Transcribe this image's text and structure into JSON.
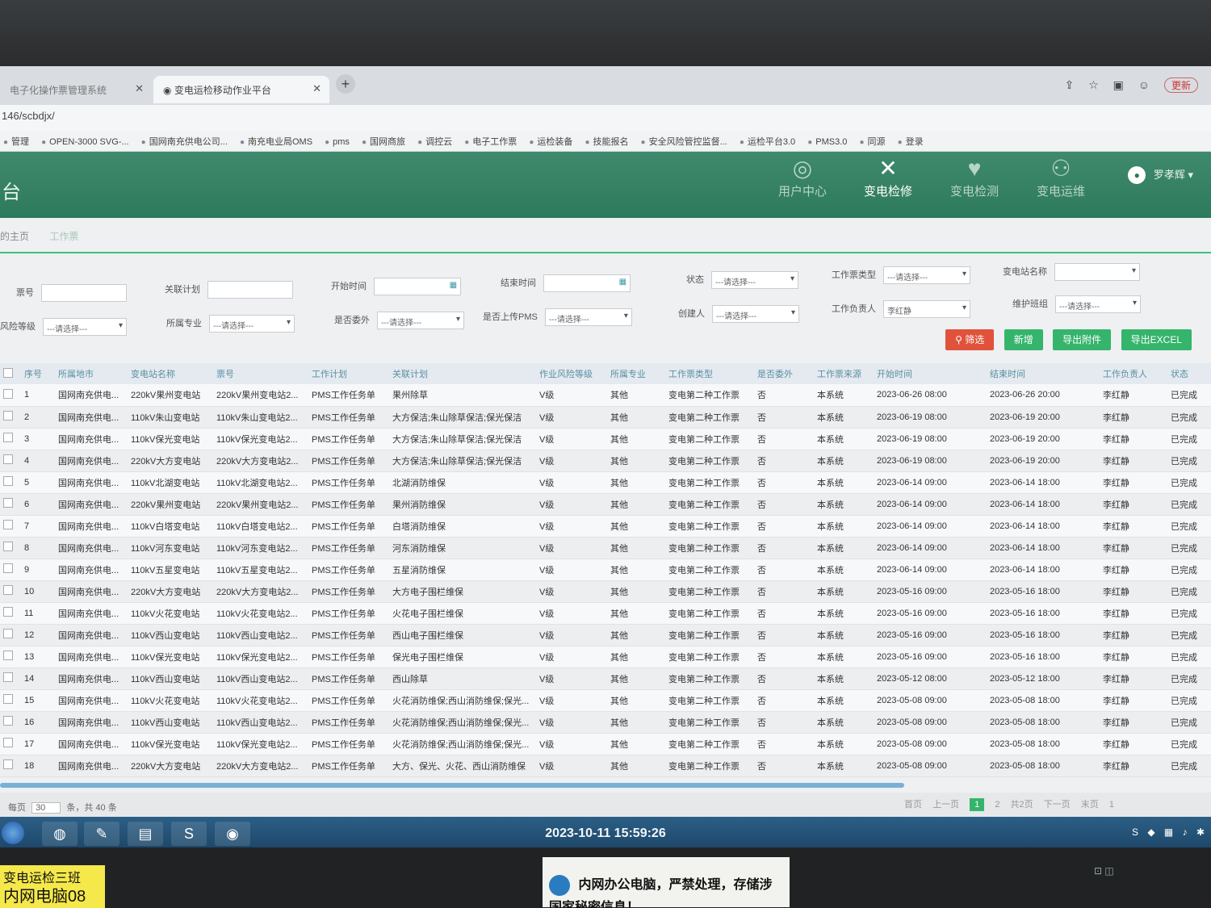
{
  "browser": {
    "tabs": [
      {
        "label": "电子化操作票管理系统",
        "active": false
      },
      {
        "label": "变电运检移动作业平台",
        "active": true
      }
    ],
    "address": "146/scbdjx/",
    "update_label": "更新",
    "bookmarks": [
      "管理",
      "OPEN-3000 SVG-...",
      "国网南充供电公司...",
      "南充电业局OMS",
      "pms",
      "国网商旅",
      "调控云",
      "电子工作票",
      "运检装备",
      "技能报名",
      "安全风险管控监督...",
      "运检平台3.0",
      "PMS3.0",
      "同源",
      "登录"
    ]
  },
  "app": {
    "title_fragment": "台",
    "nav": [
      {
        "label": "用户中心",
        "icon": "user-center-icon",
        "glyph": "◎",
        "active": false
      },
      {
        "label": "变电检修",
        "icon": "tools-icon",
        "glyph": "✕",
        "active": true
      },
      {
        "label": "变电检测",
        "icon": "pulse-icon",
        "glyph": "♥",
        "active": false
      },
      {
        "label": "变电运维",
        "icon": "network-icon",
        "glyph": "⚇",
        "active": false
      }
    ],
    "user_name": "罗孝辉"
  },
  "breadcrumb": {
    "home": "的主页",
    "current": "工作票"
  },
  "filters": {
    "ticket_no_label": "票号",
    "related_plan_label": "关联计划",
    "start_time_label": "开始时间",
    "end_time_label": "结束时间",
    "status_label": "状态",
    "status_value": "---请选择---",
    "ticket_type_label": "工作票类型",
    "ticket_type_value": "---请选择---",
    "station_name_label": "变电站名称",
    "risk_level_label": "风险等级",
    "risk_level_value": "---请选择---",
    "specialty_label": "所属专业",
    "specialty_value": "---请选择---",
    "outsourced_label": "是否委外",
    "outsourced_value": "---请选择---",
    "upload_pms_label": "是否上传PMS",
    "upload_pms_value": "---请选择---",
    "creator_label": "创建人",
    "creator_value": "---请选择---",
    "leader_label": "工作负责人",
    "leader_value": "李红静",
    "team_label": "维护班组",
    "team_value": "---请选择---"
  },
  "buttons": {
    "filter": "筛选",
    "add": "新增",
    "export_attach": "导出附件",
    "export_excel": "导出EXCEL"
  },
  "table": {
    "headers": [
      "",
      "序号",
      "所属地市",
      "变电站名称",
      "票号",
      "工作计划",
      "关联计划",
      "作业风险等级",
      "所属专业",
      "工作票类型",
      "是否委外",
      "工作票来源",
      "开始时间",
      "结束时间",
      "工作负责人",
      "状态"
    ],
    "rows": [
      [
        "1",
        "国网南充供电...",
        "220kV果州变电站",
        "220kV果州变电站2...",
        "PMS工作任务单",
        "果州除草",
        "V级",
        "其他",
        "变电第二种工作票",
        "否",
        "本系统",
        "2023-06-26 08:00",
        "2023-06-26 20:00",
        "李红静",
        "已完成"
      ],
      [
        "2",
        "国网南充供电...",
        "110kV朱山变电站",
        "110kV朱山变电站2...",
        "PMS工作任务单",
        "大方保洁;朱山除草保洁;保光保洁",
        "V级",
        "其他",
        "变电第二种工作票",
        "否",
        "本系统",
        "2023-06-19 08:00",
        "2023-06-19 20:00",
        "李红静",
        "已完成"
      ],
      [
        "3",
        "国网南充供电...",
        "110kV保光变电站",
        "110kV保光变电站2...",
        "PMS工作任务单",
        "大方保洁;朱山除草保洁;保光保洁",
        "V级",
        "其他",
        "变电第二种工作票",
        "否",
        "本系统",
        "2023-06-19 08:00",
        "2023-06-19 20:00",
        "李红静",
        "已完成"
      ],
      [
        "4",
        "国网南充供电...",
        "220kV大方变电站",
        "220kV大方变电站2...",
        "PMS工作任务单",
        "大方保洁;朱山除草保洁;保光保洁",
        "V级",
        "其他",
        "变电第二种工作票",
        "否",
        "本系统",
        "2023-06-19 08:00",
        "2023-06-19 20:00",
        "李红静",
        "已完成"
      ],
      [
        "5",
        "国网南充供电...",
        "110kV北湖变电站",
        "110kV北湖变电站2...",
        "PMS工作任务单",
        "北湖消防维保",
        "V级",
        "其他",
        "变电第二种工作票",
        "否",
        "本系统",
        "2023-06-14 09:00",
        "2023-06-14 18:00",
        "李红静",
        "已完成"
      ],
      [
        "6",
        "国网南充供电...",
        "220kV果州变电站",
        "220kV果州变电站2...",
        "PMS工作任务单",
        "果州消防维保",
        "V级",
        "其他",
        "变电第二种工作票",
        "否",
        "本系统",
        "2023-06-14 09:00",
        "2023-06-14 18:00",
        "李红静",
        "已完成"
      ],
      [
        "7",
        "国网南充供电...",
        "110kV白塔变电站",
        "110kV白塔变电站2...",
        "PMS工作任务单",
        "白塔消防维保",
        "V级",
        "其他",
        "变电第二种工作票",
        "否",
        "本系统",
        "2023-06-14 09:00",
        "2023-06-14 18:00",
        "李红静",
        "已完成"
      ],
      [
        "8",
        "国网南充供电...",
        "110kV河东变电站",
        "110kV河东变电站2...",
        "PMS工作任务单",
        "河东消防维保",
        "V级",
        "其他",
        "变电第二种工作票",
        "否",
        "本系统",
        "2023-06-14 09:00",
        "2023-06-14 18:00",
        "李红静",
        "已完成"
      ],
      [
        "9",
        "国网南充供电...",
        "110kV五星变电站",
        "110kV五星变电站2...",
        "PMS工作任务单",
        "五星消防维保",
        "V级",
        "其他",
        "变电第二种工作票",
        "否",
        "本系统",
        "2023-06-14 09:00",
        "2023-06-14 18:00",
        "李红静",
        "已完成"
      ],
      [
        "10",
        "国网南充供电...",
        "220kV大方变电站",
        "220kV大方变电站2...",
        "PMS工作任务单",
        "大方电子围栏维保",
        "V级",
        "其他",
        "变电第二种工作票",
        "否",
        "本系统",
        "2023-05-16 09:00",
        "2023-05-16 18:00",
        "李红静",
        "已完成"
      ],
      [
        "11",
        "国网南充供电...",
        "110kV火花变电站",
        "110kV火花变电站2...",
        "PMS工作任务单",
        "火花电子围栏维保",
        "V级",
        "其他",
        "变电第二种工作票",
        "否",
        "本系统",
        "2023-05-16 09:00",
        "2023-05-16 18:00",
        "李红静",
        "已完成"
      ],
      [
        "12",
        "国网南充供电...",
        "110kV西山变电站",
        "110kV西山变电站2...",
        "PMS工作任务单",
        "西山电子围栏维保",
        "V级",
        "其他",
        "变电第二种工作票",
        "否",
        "本系统",
        "2023-05-16 09:00",
        "2023-05-16 18:00",
        "李红静",
        "已完成"
      ],
      [
        "13",
        "国网南充供电...",
        "110kV保光变电站",
        "110kV保光变电站2...",
        "PMS工作任务单",
        "保光电子围栏维保",
        "V级",
        "其他",
        "变电第二种工作票",
        "否",
        "本系统",
        "2023-05-16 09:00",
        "2023-05-16 18:00",
        "李红静",
        "已完成"
      ],
      [
        "14",
        "国网南充供电...",
        "110kV西山变电站",
        "110kV西山变电站2...",
        "PMS工作任务单",
        "西山除草",
        "V级",
        "其他",
        "变电第二种工作票",
        "否",
        "本系统",
        "2023-05-12 08:00",
        "2023-05-12 18:00",
        "李红静",
        "已完成"
      ],
      [
        "15",
        "国网南充供电...",
        "110kV火花变电站",
        "110kV火花变电站2...",
        "PMS工作任务单",
        "火花消防维保;西山消防维保;保光...",
        "V级",
        "其他",
        "变电第二种工作票",
        "否",
        "本系统",
        "2023-05-08 09:00",
        "2023-05-08 18:00",
        "李红静",
        "已完成"
      ],
      [
        "16",
        "国网南充供电...",
        "110kV西山变电站",
        "110kV西山变电站2...",
        "PMS工作任务单",
        "火花消防维保;西山消防维保;保光...",
        "V级",
        "其他",
        "变电第二种工作票",
        "否",
        "本系统",
        "2023-05-08 09:00",
        "2023-05-08 18:00",
        "李红静",
        "已完成"
      ],
      [
        "17",
        "国网南充供电...",
        "110kV保光变电站",
        "110kV保光变电站2...",
        "PMS工作任务单",
        "火花消防维保;西山消防维保;保光...",
        "V级",
        "其他",
        "变电第二种工作票",
        "否",
        "本系统",
        "2023-05-08 09:00",
        "2023-05-08 18:00",
        "李红静",
        "已完成"
      ],
      [
        "18",
        "国网南充供电...",
        "220kV大方变电站",
        "220kV大方变电站2...",
        "PMS工作任务单",
        "大方、保光、火花、西山消防维保",
        "V级",
        "其他",
        "变电第二种工作票",
        "否",
        "本系统",
        "2023-05-08 09:00",
        "2023-05-08 18:00",
        "李红静",
        "已完成"
      ]
    ]
  },
  "pager": {
    "per_page_label": "每页",
    "per_page_value": "30",
    "summary": "条，共 40 条",
    "first": "首页",
    "prev": "上一页",
    "pages": [
      "1",
      "2"
    ],
    "total_pages": "共2页",
    "next": "下一页",
    "last": "末页",
    "goto_value": "1"
  },
  "taskbar": {
    "clock": "2023-10-11 15:59:26"
  },
  "stickers": {
    "yellow_line1": "变电运检三班",
    "yellow_line2": "内网电脑08",
    "warning": "内网办公电脑，严禁处理，存储涉国家秘密信息！"
  }
}
